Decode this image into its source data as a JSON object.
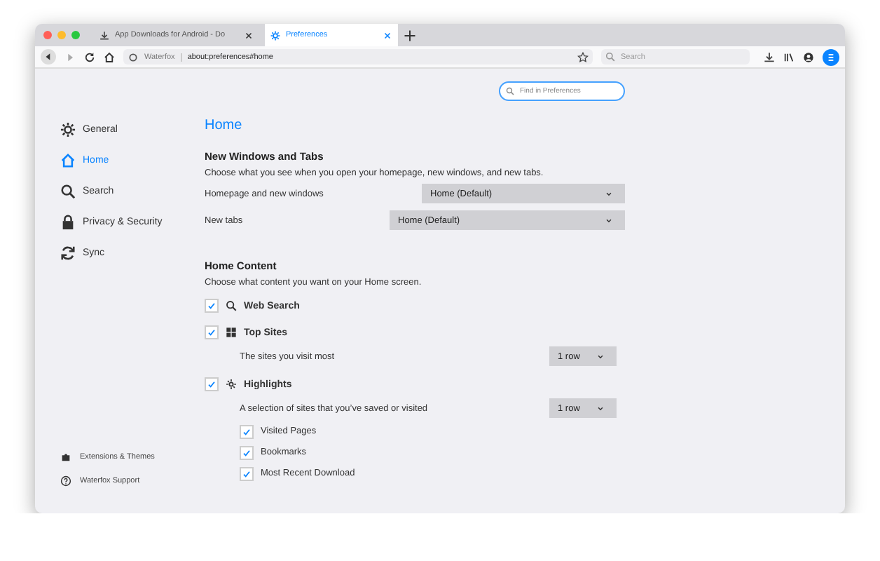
{
  "tabs": [
    {
      "title": "App Downloads for Android - Do",
      "selected": false
    },
    {
      "title": "Preferences",
      "selected": true
    }
  ],
  "toolbar": {
    "identity": "Waterfox",
    "url": "about:preferences#home",
    "search_placeholder": "Search"
  },
  "sidebar": {
    "items": [
      {
        "label": "General",
        "selected": false
      },
      {
        "label": "Home",
        "selected": true
      },
      {
        "label": "Search",
        "selected": false
      },
      {
        "label": "Privacy & Security",
        "selected": false
      },
      {
        "label": "Sync",
        "selected": false
      }
    ],
    "footer": [
      {
        "label": "Extensions & Themes"
      },
      {
        "label": "Waterfox Support"
      }
    ]
  },
  "find": {
    "placeholder": "Find in Preferences"
  },
  "page_title": "Home",
  "sections": [
    {
      "heading": "New Windows and Tabs",
      "description": "Choose what you see when you open your homepage, new windows, and new tabs.",
      "rows": [
        {
          "kind": "select",
          "label": "Homepage and new windows",
          "value": "Home (Default)"
        },
        {
          "kind": "select",
          "label": "New tabs",
          "value": "Home (Default)"
        }
      ]
    },
    {
      "heading": "Home Content",
      "description": "Choose what content you want on your Home screen.",
      "rows": [
        {
          "kind": "checkbox",
          "label": "Web Search",
          "checked": true
        },
        {
          "kind": "checkbox",
          "label": "Top Sites",
          "checked": true,
          "detail": {
            "text": "The sites you visit most",
            "value": "1 row"
          }
        },
        {
          "kind": "checkbox",
          "label": "Highlights",
          "checked": true,
          "detail": {
            "text": "A selection of sites that you’ve saved or visited",
            "value": "1 row"
          },
          "children": [
            {
              "label": "Visited Pages",
              "checked": true
            },
            {
              "label": "Bookmarks",
              "checked": true
            },
            {
              "label": "Most Recent Download",
              "checked": true
            }
          ]
        }
      ]
    }
  ]
}
